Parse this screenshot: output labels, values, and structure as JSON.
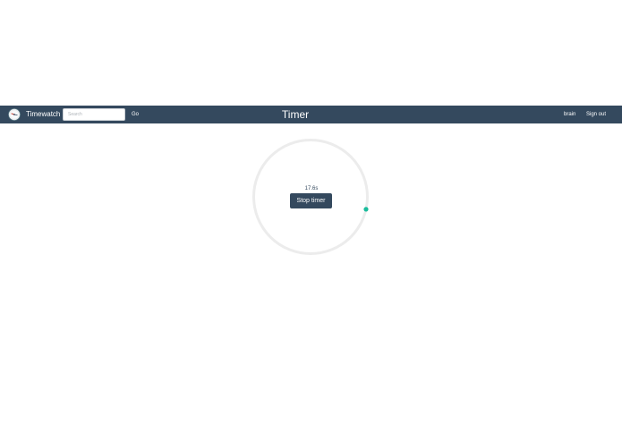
{
  "header": {
    "brand": "Timewatch",
    "logo_icon": "stopwatch-logo-icon",
    "search": {
      "placeholder": "Search",
      "value": ""
    },
    "go_label": "Go",
    "title": "Timer",
    "user_label": "brain",
    "signout_label": "Sign out"
  },
  "timer": {
    "elapsed": "17.6s",
    "stop_label": "Stop timer",
    "progress_fraction": 0.05
  },
  "colors": {
    "navbar": "#34495e",
    "ring_track": "#ececec",
    "progress_dot": "#1abc9c",
    "button": "#34495e"
  }
}
